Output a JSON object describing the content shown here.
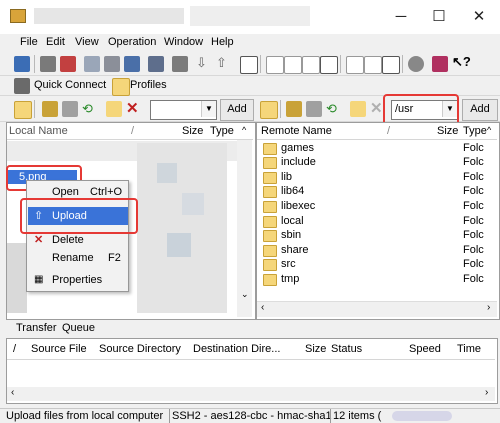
{
  "window": {
    "minimize_glyph": "─",
    "maximize_glyph": "☐",
    "close_glyph": "✕"
  },
  "menu": {
    "file": "File",
    "edit": "Edit",
    "view": "View",
    "operation": "Operation",
    "window": "Window",
    "help": "Help"
  },
  "toolbar2": {
    "quick_connect": "Quick Connect",
    "profiles": "Profiles"
  },
  "local_toolbar": {
    "path_value": "",
    "add_label": "Add"
  },
  "remote_toolbar": {
    "path_value": "/usr",
    "add_label": "Add"
  },
  "local_pane": {
    "columns": [
      "Local Name",
      "Size",
      "Type"
    ],
    "selected_file": "5.png"
  },
  "remote_pane": {
    "columns": [
      "Remote Name",
      "Size",
      "Type"
    ],
    "rows": [
      {
        "name": "games",
        "type": "Folc"
      },
      {
        "name": "include",
        "type": "Folc"
      },
      {
        "name": "lib",
        "type": "Folc"
      },
      {
        "name": "lib64",
        "type": "Folc"
      },
      {
        "name": "libexec",
        "type": "Folc"
      },
      {
        "name": "local",
        "type": "Folc"
      },
      {
        "name": "sbin",
        "type": "Folc"
      },
      {
        "name": "share",
        "type": "Folc"
      },
      {
        "name": "src",
        "type": "Folc"
      },
      {
        "name": "tmp",
        "type": "Folc"
      }
    ]
  },
  "context_menu": {
    "open": "Open",
    "open_shortcut": "Ctrl+O",
    "upload": "Upload",
    "delete": "Delete",
    "rename": "Rename",
    "rename_shortcut": "F2",
    "properties": "Properties"
  },
  "transfer": {
    "tab_transfer": "Transfer",
    "tab_queue": "Queue",
    "columns": {
      "slash": "/",
      "source_file": "Source File",
      "source_directory": "Source Directory",
      "destination_directory": "Destination Dire...",
      "size": "Size",
      "status": "Status",
      "speed": "Speed",
      "time": "Time"
    }
  },
  "status": {
    "message": "Upload files from local computer",
    "cipher": "SSH2 - aes128-cbc - hmac-sha1",
    "items": "12 items ("
  },
  "colors": {
    "highlight": "#3a73d8",
    "annotation_red": "#e53935",
    "folder": "#f5d67a"
  }
}
